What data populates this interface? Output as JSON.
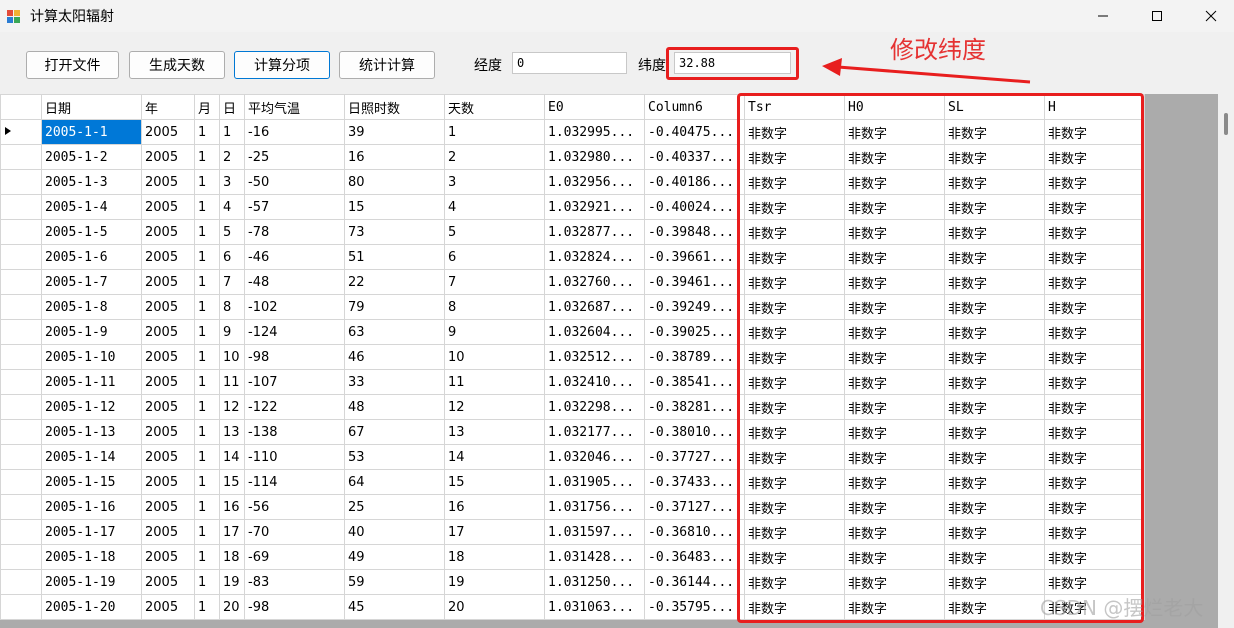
{
  "window": {
    "title": "计算太阳辐射"
  },
  "toolbar": {
    "open_file": "打开文件",
    "gen_days": "生成天数",
    "calc_items": "计算分项",
    "stat_calc": "统计计算",
    "longitude_label": "经度",
    "longitude_value": "0",
    "latitude_label": "纬度",
    "latitude_value": "32.88"
  },
  "annotation": "修改纬度",
  "grid": {
    "columns": [
      "日期",
      "年",
      "月",
      "日",
      "平均气温",
      "日照时数",
      "天数",
      "E0",
      "Column6",
      "Tsr",
      "H0",
      "SL",
      "H"
    ],
    "rows": [
      [
        "2005-1-1",
        "2005",
        "1",
        "1",
        "-16",
        "39",
        "1",
        "1.032995...",
        "-0.40475...",
        "非数字",
        "非数字",
        "非数字",
        "非数字"
      ],
      [
        "2005-1-2",
        "2005",
        "1",
        "2",
        "-25",
        "16",
        "2",
        "1.032980...",
        "-0.40337...",
        "非数字",
        "非数字",
        "非数字",
        "非数字"
      ],
      [
        "2005-1-3",
        "2005",
        "1",
        "3",
        "-50",
        "80",
        "3",
        "1.032956...",
        "-0.40186...",
        "非数字",
        "非数字",
        "非数字",
        "非数字"
      ],
      [
        "2005-1-4",
        "2005",
        "1",
        "4",
        "-57",
        "15",
        "4",
        "1.032921...",
        "-0.40024...",
        "非数字",
        "非数字",
        "非数字",
        "非数字"
      ],
      [
        "2005-1-5",
        "2005",
        "1",
        "5",
        "-78",
        "73",
        "5",
        "1.032877...",
        "-0.39848...",
        "非数字",
        "非数字",
        "非数字",
        "非数字"
      ],
      [
        "2005-1-6",
        "2005",
        "1",
        "6",
        "-46",
        "51",
        "6",
        "1.032824...",
        "-0.39661...",
        "非数字",
        "非数字",
        "非数字",
        "非数字"
      ],
      [
        "2005-1-7",
        "2005",
        "1",
        "7",
        "-48",
        "22",
        "7",
        "1.032760...",
        "-0.39461...",
        "非数字",
        "非数字",
        "非数字",
        "非数字"
      ],
      [
        "2005-1-8",
        "2005",
        "1",
        "8",
        "-102",
        "79",
        "8",
        "1.032687...",
        "-0.39249...",
        "非数字",
        "非数字",
        "非数字",
        "非数字"
      ],
      [
        "2005-1-9",
        "2005",
        "1",
        "9",
        "-124",
        "63",
        "9",
        "1.032604...",
        "-0.39025...",
        "非数字",
        "非数字",
        "非数字",
        "非数字"
      ],
      [
        "2005-1-10",
        "2005",
        "1",
        "10",
        "-98",
        "46",
        "10",
        "1.032512...",
        "-0.38789...",
        "非数字",
        "非数字",
        "非数字",
        "非数字"
      ],
      [
        "2005-1-11",
        "2005",
        "1",
        "11",
        "-107",
        "33",
        "11",
        "1.032410...",
        "-0.38541...",
        "非数字",
        "非数字",
        "非数字",
        "非数字"
      ],
      [
        "2005-1-12",
        "2005",
        "1",
        "12",
        "-122",
        "48",
        "12",
        "1.032298...",
        "-0.38281...",
        "非数字",
        "非数字",
        "非数字",
        "非数字"
      ],
      [
        "2005-1-13",
        "2005",
        "1",
        "13",
        "-138",
        "67",
        "13",
        "1.032177...",
        "-0.38010...",
        "非数字",
        "非数字",
        "非数字",
        "非数字"
      ],
      [
        "2005-1-14",
        "2005",
        "1",
        "14",
        "-110",
        "53",
        "14",
        "1.032046...",
        "-0.37727...",
        "非数字",
        "非数字",
        "非数字",
        "非数字"
      ],
      [
        "2005-1-15",
        "2005",
        "1",
        "15",
        "-114",
        "64",
        "15",
        "1.031905...",
        "-0.37433...",
        "非数字",
        "非数字",
        "非数字",
        "非数字"
      ],
      [
        "2005-1-16",
        "2005",
        "1",
        "16",
        "-56",
        "25",
        "16",
        "1.031756...",
        "-0.37127...",
        "非数字",
        "非数字",
        "非数字",
        "非数字"
      ],
      [
        "2005-1-17",
        "2005",
        "1",
        "17",
        "-70",
        "40",
        "17",
        "1.031597...",
        "-0.36810...",
        "非数字",
        "非数字",
        "非数字",
        "非数字"
      ],
      [
        "2005-1-18",
        "2005",
        "1",
        "18",
        "-69",
        "49",
        "18",
        "1.031428...",
        "-0.36483...",
        "非数字",
        "非数字",
        "非数字",
        "非数字"
      ],
      [
        "2005-1-19",
        "2005",
        "1",
        "19",
        "-83",
        "59",
        "19",
        "1.031250...",
        "-0.36144...",
        "非数字",
        "非数字",
        "非数字",
        "非数字"
      ],
      [
        "2005-1-20",
        "2005",
        "1",
        "20",
        "-98",
        "45",
        "20",
        "1.031063...",
        "-0.35795...",
        "非数字",
        "非数字",
        "非数字",
        "非数字"
      ]
    ]
  },
  "watermark": "CSDN @摆烂老大",
  "colors": {
    "highlight": "#e81e1e",
    "selection": "#0078d7",
    "annotation": "#e53232"
  }
}
